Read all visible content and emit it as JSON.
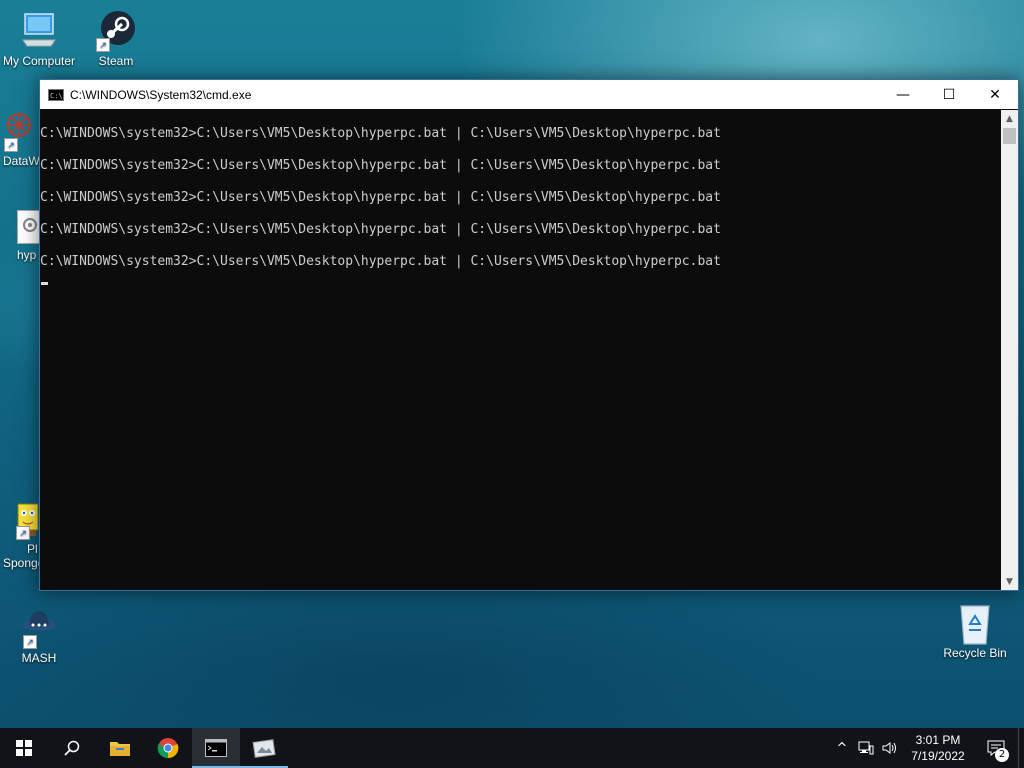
{
  "desktop": {
    "icons": [
      {
        "label": "My Computer"
      },
      {
        "label": "Steam"
      },
      {
        "label": "DataW"
      },
      {
        "label": "hyp"
      },
      {
        "label": "Pl"
      },
      {
        "label": "Sponge"
      },
      {
        "label": "MASH"
      },
      {
        "label": "Recycle Bin"
      }
    ]
  },
  "cmd": {
    "title": "C:\\WINDOWS\\System32\\cmd.exe",
    "lines": [
      "C:\\WINDOWS\\system32>C:\\Users\\VM5\\Desktop\\hyperpc.bat | C:\\Users\\VM5\\Desktop\\hyperpc.bat",
      "C:\\WINDOWS\\system32>C:\\Users\\VM5\\Desktop\\hyperpc.bat | C:\\Users\\VM5\\Desktop\\hyperpc.bat",
      "C:\\WINDOWS\\system32>C:\\Users\\VM5\\Desktop\\hyperpc.bat | C:\\Users\\VM5\\Desktop\\hyperpc.bat",
      "C:\\WINDOWS\\system32>C:\\Users\\VM5\\Desktop\\hyperpc.bat | C:\\Users\\VM5\\Desktop\\hyperpc.bat",
      "C:\\WINDOWS\\system32>C:\\Users\\VM5\\Desktop\\hyperpc.bat | C:\\Users\\VM5\\Desktop\\hyperpc.bat"
    ],
    "minimize_glyph": "—",
    "maximize_glyph": "☐",
    "close_glyph": "✕"
  },
  "taskbar": {
    "clock_time": "3:01 PM",
    "clock_date": "7/19/2022",
    "notification_count": "2",
    "chevron_glyph": "^"
  },
  "colors": {
    "console_bg": "#0c0c0c",
    "console_fg": "#cccccc",
    "taskbar_bg": "#101418",
    "accent": "#76b9ed"
  }
}
